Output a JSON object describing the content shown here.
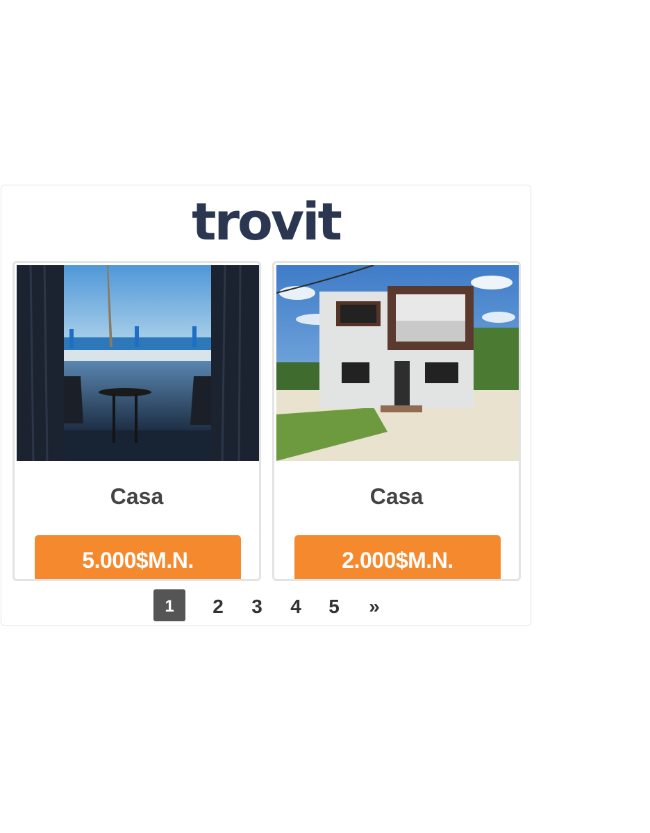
{
  "widget": {
    "logo_text": "trovit",
    "listings": [
      {
        "title": "Casa",
        "price": "5.000$M.N.",
        "photo": "pool-terrace-photo"
      },
      {
        "title": "Casa",
        "price": "2.000$M.N.",
        "photo": "two-story-house-photo"
      }
    ],
    "pagination": {
      "pages": [
        "1",
        "2",
        "3",
        "4",
        "5"
      ],
      "current": "1",
      "next_label": "»"
    }
  },
  "colors": {
    "logo": "#2b3651",
    "price_button": "#f5892d",
    "active_page": "#555555",
    "card_border": "#e3e3e3"
  }
}
